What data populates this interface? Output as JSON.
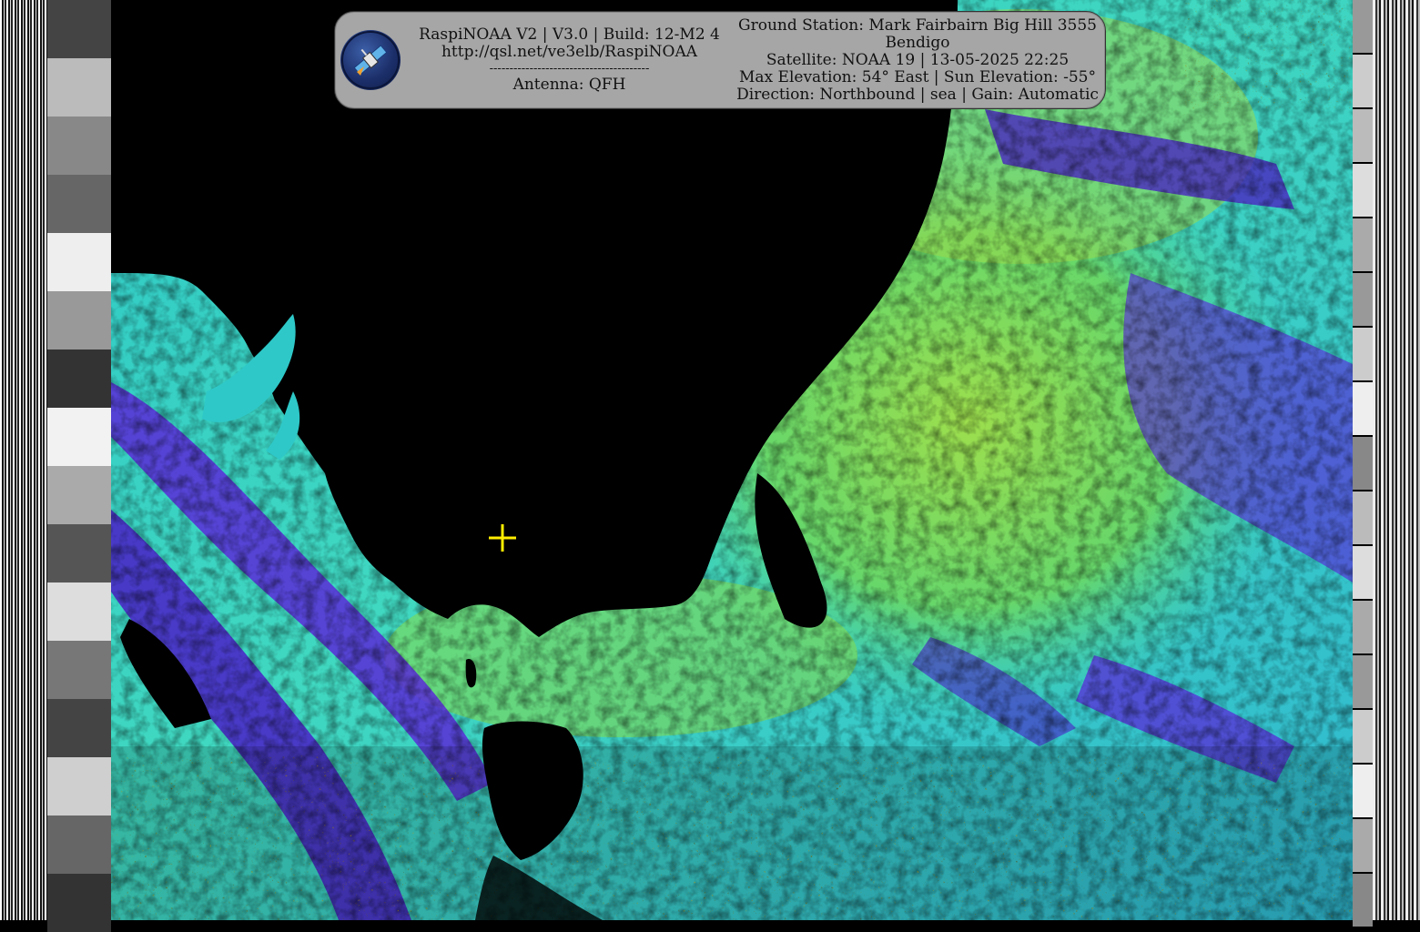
{
  "overlay": {
    "left_lines": [
      "RaspiNOAA V2 | V3.0 | Build: 12-M2 4",
      "http://qsl.net/ve3elb/RaspiNOAA",
      "----------------------------------------",
      "Antenna: QFH"
    ],
    "right_lines": [
      "Ground Station: Mark Fairbairn Big Hill 3555",
      "Bendigo",
      "Satellite: NOAA 19 | 13-05-2025 22:25",
      "Max Elevation: 54° East | Sun Elevation: -55°",
      "Direction: Northbound | sea | Gain: Automatic"
    ]
  },
  "colors": {
    "panel_bg": "#a6a6a6",
    "crosshair": "#ffee00",
    "sea_black": "#000000"
  },
  "icons": {
    "logo": "satellite-logo-icon",
    "marker": "crosshair-icon"
  }
}
